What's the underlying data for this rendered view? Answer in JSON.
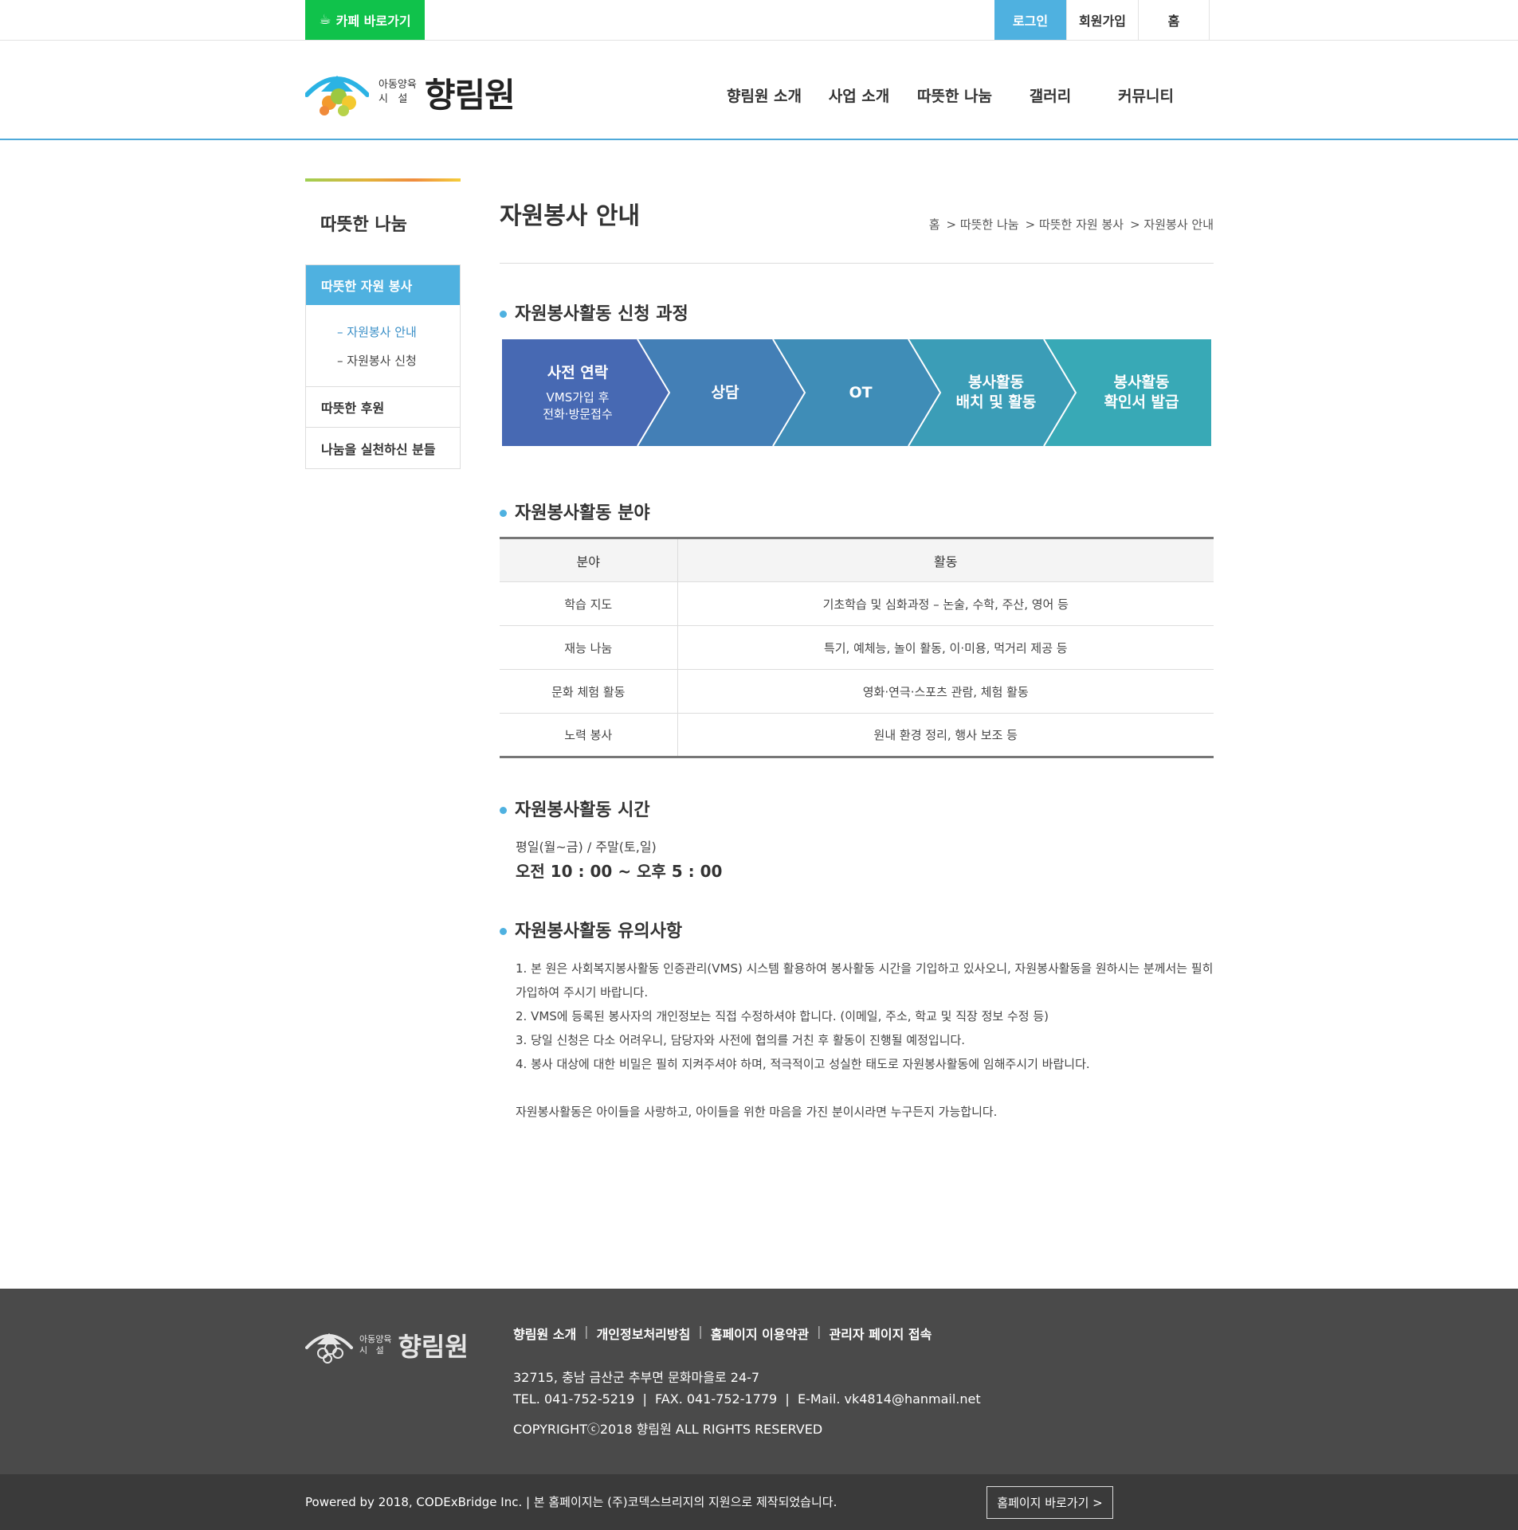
{
  "topbar": {
    "cafe_label": "카페 바로가기",
    "login": "로그인",
    "join": "회원가입",
    "home": "홈"
  },
  "logo": {
    "small_line1": "아동양육",
    "small_line2": "시   설",
    "name": "향림원"
  },
  "gnb": [
    "향림원 소개",
    "사업 소개",
    "따뜻한 나눔",
    "갤러리",
    "커뮤니티"
  ],
  "sidebar": {
    "title": "따뜻한 나눔",
    "active": "따뜻한 자원 봉사",
    "subs": [
      "– 자원봉사 안내",
      "– 자원봉사 신청"
    ],
    "items": [
      "따뜻한 후원",
      "나눔을 실천하신 분들"
    ]
  },
  "page": {
    "title": "자원봉사 안내",
    "breadcrumb": [
      "홈",
      "> 따뜻한 나눔",
      "> 따뜻한 자원 봉사",
      "> 자원봉사 안내"
    ]
  },
  "process": {
    "title": "자원봉사활동 신청 과정",
    "steps": [
      {
        "title": "사전 연락",
        "desc": "VMS가입 후\n전화·방문접수"
      },
      {
        "title": "상담",
        "desc": ""
      },
      {
        "title": "OT",
        "desc": ""
      },
      {
        "title": "봉사활동\n배치 및 활동",
        "desc": ""
      },
      {
        "title": "봉사활동\n확인서 발급",
        "desc": ""
      }
    ],
    "colors": [
      "#4769b3",
      "#437fb6",
      "#3f8db7",
      "#3b9db7",
      "#38a9b6"
    ]
  },
  "fields": {
    "title": "자원봉사활동 분야",
    "headers": [
      "분야",
      "활동"
    ],
    "rows": [
      [
        "학습 지도",
        "기초학습 및 심화과정 – 논술, 수학, 주산, 영어 등"
      ],
      [
        "재능 나눔",
        "특기, 예체능, 놀이 활동, 이·미용, 먹거리 제공 등"
      ],
      [
        "문화 체험 활동",
        "영화·연극·스포츠 관람, 체험 활동"
      ],
      [
        "노력 봉사",
        "원내 환경 정리, 행사 보조 등"
      ]
    ]
  },
  "time": {
    "title": "자원봉사활동 시간",
    "days": "평일(월~금) / 주말(토,일)",
    "hours": "오전 10 : 00 ~ 오후 5 : 00"
  },
  "notes": {
    "title": "자원봉사활동 유의사항",
    "items": [
      "1. 본 원은 사회복지봉사활동 인증관리(VMS) 시스템 활용하여 봉사활동 시간을 기입하고 있사오니, 자원봉사활동을 원하시는 분께서는 필히 가입하여 주시기 바랍니다.",
      "2. VMS에 등록된 봉사자의 개인정보는 직접 수정하셔야 합니다. (이메일, 주소, 학교 및 직장 정보 수정 등)",
      "3. 당일 신청은 다소 어려우니, 담당자와 사전에 협의를 거친 후 활동이 진행될 예정입니다.",
      "4. 봉사 대상에 대한 비밀은 필히 지켜주셔야 하며, 적극적이고 성실한 태도로 자원봉사활동에 임해주시기 바랍니다."
    ],
    "closing": "자원봉사활동은 아이들을 사랑하고, 아이들을 위한 마음을 가진 분이시라면 누구든지 가능합니다."
  },
  "footer": {
    "logo_small1": "아동양육",
    "logo_small2": "시   설",
    "logo_name": "향림원",
    "links": [
      "향림원 소개",
      "개인정보처리방침",
      "홈페이지 이용약관",
      "관리자 페이지 접속"
    ],
    "separator": "|",
    "address": "32715, 충남 금산군 추부면 문화마을로 24-7",
    "contact": "TEL. 041-752-5219  |  FAX. 041-752-1779  |  E-Mail. vk4814@hanmail.net",
    "copyright": "COPYRIGHTⓒ2018 향림원 ALL RIGHTS RESERVED",
    "powered": "Powered by 2018, CODExBridge Inc. | 본 홈페이지는 (주)코덱스브리지의 지원으로 제작되었습니다.",
    "homepage_btn": "홈페이지 바로가기 >"
  }
}
